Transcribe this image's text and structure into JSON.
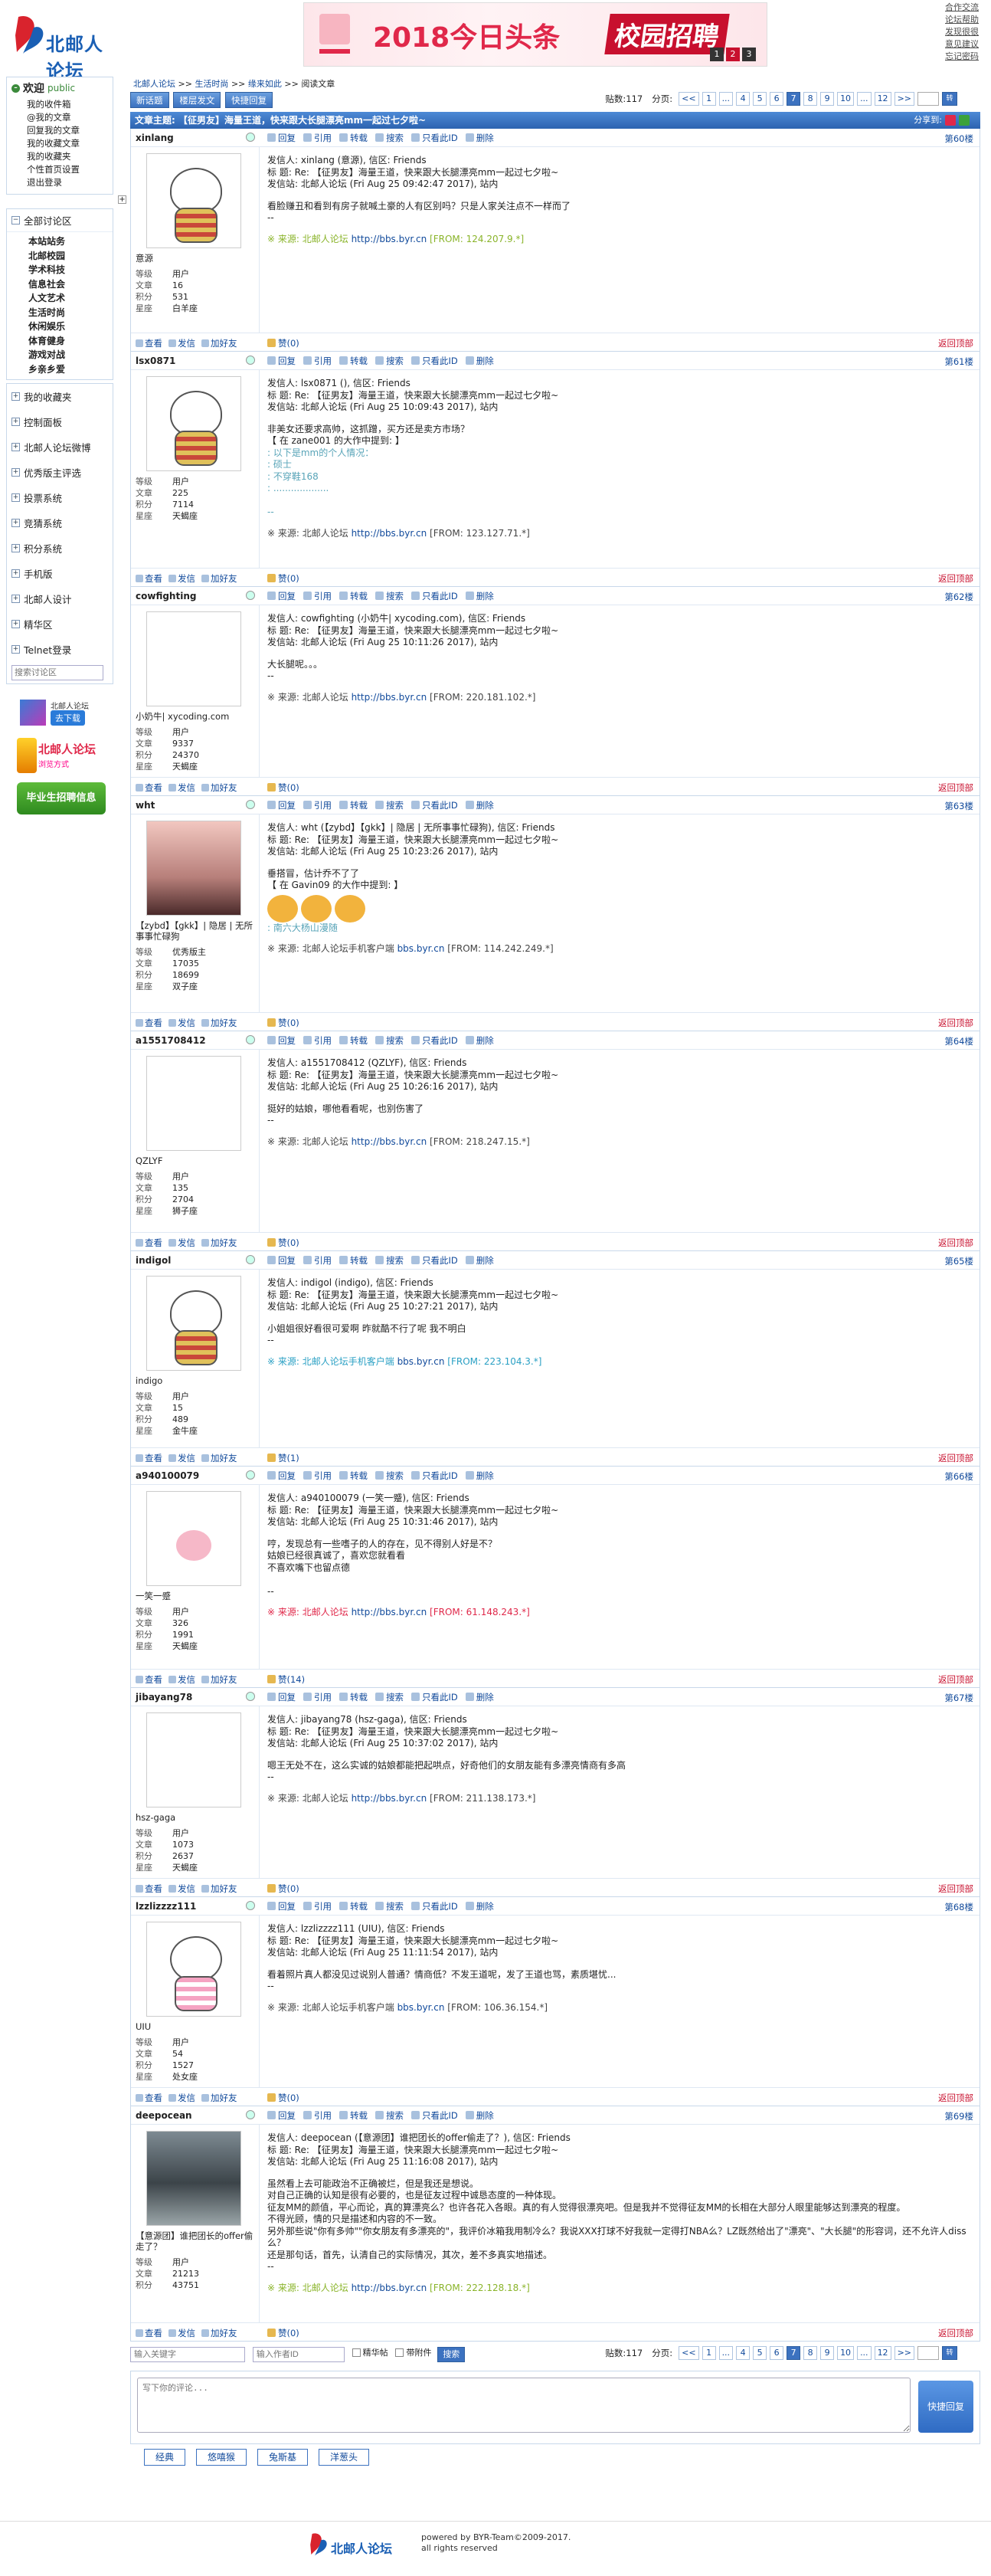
{
  "site": {
    "logo_text": "北邮人论坛",
    "banner_text": "2018今日头条",
    "banner_text2": "校园招聘",
    "banner_pages": [
      "1",
      "2",
      "3"
    ],
    "top_links": [
      "合作交流",
      "论坛帮助",
      "发现很很",
      "意见建议",
      "忘记密码"
    ]
  },
  "sidebar": {
    "welcome_title": "欢迎",
    "welcome_user": "public",
    "links": [
      "我的收件箱",
      "@我的文章",
      "回复我的文章",
      "我的收藏文章",
      "我的收藏夹",
      "个性首页设置",
      "退出登录"
    ],
    "all_sections_label": "全部讨论区",
    "sections": [
      "本站站务",
      "北邮校园",
      "学术科技",
      "信息社会",
      "人文艺术",
      "生活时尚",
      "休闲娱乐",
      "体育健身",
      "游戏对战",
      "乡亲乡爱"
    ],
    "menu": [
      "我的收藏夹",
      "控制面板",
      "北邮人论坛微博",
      "优秀版主评选",
      "投票系统",
      "竞猜系统",
      "积分系统",
      "手机版",
      "北邮人设计",
      "精华区",
      "Telnet登录"
    ],
    "search_placeholder": "搜索讨论区",
    "promo1_title": "北邮人论坛",
    "promo1_btn": "去下载",
    "promo2_title": "北邮人论坛",
    "promo2_sub": "浏览方式",
    "promo3": "毕业生招聘信息",
    "toggle": "+"
  },
  "main": {
    "breadcrumb": [
      "北邮人论坛",
      ">>",
      "生活时尚",
      ">>",
      "缘来如此",
      ">>",
      "阅读文章"
    ],
    "toolbar_buttons": [
      "新话题",
      "楼层发文",
      "快捷回复"
    ],
    "post_count_label": "贴数:117",
    "page_label": "分页:",
    "pages": [
      "<<",
      "1",
      "...",
      "4",
      "5",
      "6",
      "7",
      "8",
      "9",
      "10",
      "...",
      "12",
      ">>"
    ],
    "current_page": "7",
    "go_label": "转",
    "title": "文章主题: 【征男友】海量王道，快来跟大长腿漂亮mm一起过七夕啦~",
    "share_label": "分享到:",
    "post_actions": [
      "回复",
      "引用",
      "转载",
      "搜索",
      "只看此ID",
      "删除"
    ],
    "foot_actions": [
      "查看",
      "发信",
      "加好友"
    ],
    "back_top": "返回顶部",
    "posts": [
      {
        "user": "xinlang",
        "floor": "第60楼",
        "avatar": "bear",
        "nick": "意源",
        "stats": [
          [
            "等级",
            "用户"
          ],
          [
            "文章",
            "16"
          ],
          [
            "积分",
            "531"
          ],
          [
            "星座",
            "白羊座"
          ]
        ],
        "hdr": [
          "发信人: xinlang (意源), 信区: Friends",
          "标  题: Re: 【征男友】海量王道，快来跟大长腿漂亮mm一起过七夕啦~",
          "发信站: 北邮人论坛 (Fri Aug 25 09:42:47 2017), 站内"
        ],
        "content": "看脸赚丑和看到有房子就喊土豪的人有区别吗？只是人家关注点不一样而了\n--",
        "quote": "",
        "src_prefix": "※ 来源: 北邮人论坛",
        "src_link": "http://bbs.byr.cn",
        "src_from": "[FROM: 124.207.9.*]",
        "src_color": "green",
        "like": "赞(0)",
        "body_h": 242
      },
      {
        "user": "lsx0871",
        "floor": "第61楼",
        "avatar": "bear",
        "nick": "",
        "stats": [
          [
            "等级",
            "用户"
          ],
          [
            "文章",
            "225"
          ],
          [
            "积分",
            "7114"
          ],
          [
            "星座",
            "天蝎座"
          ]
        ],
        "hdr": [
          "发信人: lsx0871 (), 信区: Friends",
          "标  题: Re: 【征男友】海量王道，快来跟大长腿漂亮mm一起过七夕啦~",
          "发信站: 北邮人论坛 (Fri Aug 25 10:09:43 2017), 站内"
        ],
        "content": "非美女还要求高帅，这抓蹭，买方还是卖方市场？\n【 在 zane001 的大作中提到: 】",
        "quote": ": 以下是mm的个人情况：\n: 硕士\n: 不穿鞋168\n: ...................\n\n--",
        "src_prefix": "※ 来源: 北邮人论坛",
        "src_link": "http://bbs.byr.cn",
        "src_from": "[FROM: 123.127.71.*]",
        "src_color": "",
        "like": "赞(0)",
        "body_h": 258
      },
      {
        "user": "cowfighting",
        "floor": "第62楼",
        "avatar": "none",
        "nick": "小奶牛| xycoding.com",
        "stats": [
          [
            "等级",
            "用户"
          ],
          [
            "文章",
            "9337"
          ],
          [
            "积分",
            "24370"
          ],
          [
            "星座",
            "天蝎座"
          ]
        ],
        "hdr": [
          "发信人: cowfighting (小奶牛| xycoding.com), 信区: Friends",
          "标  题: Re: 【征男友】海量王道，快来跟大长腿漂亮mm一起过七夕啦~",
          "发信站: 北邮人论坛 (Fri Aug 25 10:11:26 2017), 站内"
        ],
        "content": "大长腿呢。。。\n--",
        "quote": "",
        "src_prefix": "※ 来源: 北邮人论坛",
        "src_link": "http://bbs.byr.cn",
        "src_from": "[FROM: 220.181.102.*]",
        "src_color": "",
        "like": "赞(0)",
        "body_h": 210
      },
      {
        "user": "wht",
        "floor": "第63楼",
        "avatar": "girl",
        "nick": "【zybd】【gkk】| 隐居 | 无所事事忙碌狗",
        "stats": [
          [
            "等级",
            "优秀版主"
          ],
          [
            "文章",
            "17035"
          ],
          [
            "积分",
            "18699"
          ],
          [
            "星座",
            "双子座"
          ]
        ],
        "hdr": [
          "发信人: wht (【zybd】【gkk】| 隐居 | 无所事事忙碌狗), 信区: Friends",
          "标  题: Re: 【征男友】海量王道，快来跟大长腿漂亮mm一起过七夕啦~",
          "发信站: 北邮人论坛 (Fri Aug 25 10:23:26 2017), 站内"
        ],
        "content": "垂搭冒，估计乔不了了\n【 在 Gavin09 的大作中提到: 】",
        "quote": ": 南六大杨山漫随",
        "src_prefix": "※ 来源: 北邮人论坛手机客户端",
        "src_link": "bbs.byr.cn",
        "src_from": "[FROM: 114.242.249.*]",
        "src_color": "",
        "like": "赞(0)",
        "body_h": 258
      },
      {
        "user": "a1551708412",
        "floor": "第64楼",
        "avatar": "none",
        "nick": "QZLYF",
        "stats": [
          [
            "等级",
            "用户"
          ],
          [
            "文章",
            "135"
          ],
          [
            "积分",
            "2704"
          ],
          [
            "星座",
            "狮子座"
          ]
        ],
        "hdr": [
          "发信人: a1551708412 (QZLYF), 信区: Friends",
          "标  题: Re: 【征男友】海量王道，快来跟大长腿漂亮mm一起过七夕啦~",
          "发信站: 北邮人论坛 (Fri Aug 25 10:26:16 2017), 站内"
        ],
        "content": "挺好的姑娘，哪他看看呢，也别伤害了\n--",
        "quote": "",
        "src_prefix": "※ 来源: 北邮人论坛",
        "src_link": "http://bbs.byr.cn",
        "src_from": "[FROM: 218.247.15.*]",
        "src_color": "",
        "like": "赞(0)",
        "body_h": 238
      },
      {
        "user": "indigol",
        "floor": "第65楼",
        "avatar": "bear",
        "nick": "indigo",
        "stats": [
          [
            "等级",
            "用户"
          ],
          [
            "文章",
            "15"
          ],
          [
            "积分",
            "489"
          ],
          [
            "星座",
            "金牛座"
          ]
        ],
        "hdr": [
          "发信人: indigol (indigo), 信区: Friends",
          "标  题: Re: 【征男友】海量王道，快来跟大长腿漂亮mm一起过七夕啦~",
          "发信站: 北邮人论坛 (Fri Aug 25 10:27:21 2017), 站内"
        ],
        "content": "小姐姐很好看很可爱啊 昨就酷不行了呢 我不明白\n--",
        "quote": "",
        "src_prefix": "※ 来源: 北邮人论坛手机客户端",
        "src_link": "bbs.byr.cn",
        "src_from": "[FROM: 223.104.3.*]",
        "src_color": "cyan",
        "like": "赞(1)",
        "body_h": 232
      },
      {
        "user": "a940100079",
        "floor": "第66楼",
        "avatar": "rabbit",
        "nick": "一笑一蹙",
        "stats": [
          [
            "等级",
            "用户"
          ],
          [
            "文章",
            "326"
          ],
          [
            "积分",
            "1991"
          ],
          [
            "星座",
            "天蝎座"
          ]
        ],
        "hdr": [
          "发信人: a940100079 (一笑一蹙), 信区: Friends",
          "标  题: Re: 【征男友】海量王道，快来跟大长腿漂亮mm一起过七夕啦~",
          "发信站: 北邮人论坛 (Fri Aug 25 10:31:46 2017), 站内"
        ],
        "content": "哼，发现总有一些嗜子的人的存在，见不得别人好是不？\n姑娘已经很真诚了，喜欢您就看看\n不喜欢嘴下也留点德\n\n--",
        "quote": "",
        "src_prefix": "※ 来源: 北邮人论坛",
        "src_link": "http://bbs.byr.cn",
        "src_from": "[FROM: 61.148.243.*]",
        "src_color": "red",
        "like": "赞(14)",
        "body_h": 240
      },
      {
        "user": "jibayang78",
        "floor": "第67楼",
        "avatar": "none",
        "nick": "hsz-gaga",
        "stats": [
          [
            "等级",
            "用户"
          ],
          [
            "文章",
            "1073"
          ],
          [
            "积分",
            "2637"
          ],
          [
            "星座",
            "天蝎座"
          ]
        ],
        "hdr": [
          "发信人: jibayang78 (hsz-gaga), 信区: Friends",
          "标  题: Re: 【征男友】海量王道，快来跟大长腿漂亮mm一起过七夕啦~",
          "发信站: 北邮人论坛 (Fri Aug 25 10:37:02 2017), 站内"
        ],
        "content": "嗯王无处不在，这么实诚的姑娘都能把起哄点，好奇他们的女朋友能有多漂亮情商有多高\n--",
        "quote": "",
        "src_prefix": "※ 来源: 北邮人论坛",
        "src_link": "http://bbs.byr.cn",
        "src_from": "[FROM: 211.138.173.*]",
        "src_color": "",
        "like": "赞(0)",
        "body_h": 200
      },
      {
        "user": "lzzlizzzz111",
        "floor": "第68楼",
        "avatar": "pink",
        "nick": "UIU",
        "stats": [
          [
            "等级",
            "用户"
          ],
          [
            "文章",
            "54"
          ],
          [
            "积分",
            "1527"
          ],
          [
            "星座",
            "处女座"
          ]
        ],
        "hdr": [
          "发信人: lzzlizzzz111 (UIU), 信区: Friends",
          "标  题: Re: 【征男友】海量王道，快来跟大长腿漂亮mm一起过七夕啦~",
          "发信站: 北邮人论坛 (Fri Aug 25 11:11:54 2017), 站内"
        ],
        "content": "看着照片真人都没见过说别人普通？情商低？不发王道呢，发了王道也骂，素质堪忧...\n--",
        "quote": "",
        "src_prefix": "※ 来源: 北邮人论坛手机客户端",
        "src_link": "bbs.byr.cn",
        "src_from": "[FROM: 106.36.154.*]",
        "src_color": "",
        "like": "赞(0)",
        "body_h": 220
      },
      {
        "user": "deepocean",
        "floor": "第69楼",
        "avatar": "photo",
        "nick": "【意源团】谁把团长的offer偷走了？",
        "stats": [
          [
            "等级",
            "用户"
          ],
          [
            "文章",
            "21213"
          ],
          [
            "积分",
            "43751"
          ]
        ],
        "hdr": [
          "发信人: deepocean (【意源团】谁把团长的offer偷走了？), 信区: Friends",
          "标  题: Re: 【征男友】海量王道，快来跟大长腿漂亮mm一起过七夕啦~",
          "发信站: 北邮人论坛 (Fri Aug 25 11:16:08 2017), 站内"
        ],
        "content": "虽然看上去可能政治不正确被烂，但是我还是想说。\n对自己正确的认知是很有必要的，也是征友过程中诚恳态度的一种体现。\n征友MM的颜值，平心而论，真的算漂亮么？也许各花入各眼。真的有人觉得很漂亮吧。但是我并不觉得征友MM的长相在大部分人眼里能够达到漂亮的程度。\n不得光顾，情的只是描述和内容的不一致。\n另外那些说\"你有多帅\"\"你女朋友有多漂亮的\"，我评价冰箱我用制冷么？我说XXX打球不好我就一定得打NBA么？LZ既然给出了\"漂亮\"、\"大长腿\"的形容词，还不允许人diss么？\n还是那句话，首先，认清自己的实际情况，其次，差不多真实地描述。\n--",
        "quote": "",
        "src_prefix": "※ 来源: 北邮人论坛",
        "src_link": "http://bbs.byr.cn",
        "src_from": "[FROM: 222.128.18.*]",
        "src_color": "green",
        "like": "赞(0)",
        "body_h": 258
      }
    ],
    "search_keyword_placeholder": "输入关键字",
    "search_author_placeholder": "输入作者ID",
    "chk_only": "精华帖",
    "chk_attach": "带附件",
    "search_btn": "搜索",
    "reply_placeholder": "写下你的评论...",
    "reply_btn": "快捷回复",
    "emo_tabs": [
      "经典",
      "悠嘻猴",
      "兔斯基",
      "洋葱头"
    ]
  },
  "footer": {
    "logo_text": "北邮人论坛",
    "powered": "powered by BYR-Team©2009-2017.",
    "rights": "all rights reserved"
  }
}
